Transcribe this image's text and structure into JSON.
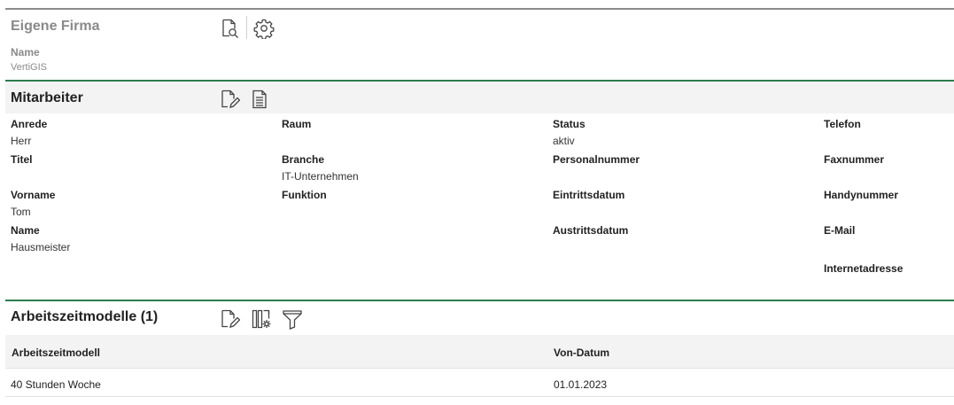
{
  "company": {
    "title": "Eigene Firma",
    "name_label": "Name",
    "name_value": "VertiGIS"
  },
  "employee": {
    "title": "Mitarbeiter",
    "fields": {
      "anrede": {
        "label": "Anrede",
        "value": "Herr"
      },
      "titel": {
        "label": "Titel",
        "value": ""
      },
      "vorname": {
        "label": "Vorname",
        "value": "Tom"
      },
      "name": {
        "label": "Name",
        "value": "Hausmeister"
      },
      "raum": {
        "label": "Raum",
        "value": ""
      },
      "branche": {
        "label": "Branche",
        "value": "IT-Unternehmen"
      },
      "funktion": {
        "label": "Funktion",
        "value": ""
      },
      "status": {
        "label": "Status",
        "value": "aktiv"
      },
      "personalnummer": {
        "label": "Personalnummer",
        "value": ""
      },
      "eintrittsdatum": {
        "label": "Eintrittsdatum",
        "value": ""
      },
      "austrittsdatum": {
        "label": "Austrittsdatum",
        "value": ""
      },
      "telefon": {
        "label": "Telefon",
        "value": ""
      },
      "faxnummer": {
        "label": "Faxnummer",
        "value": ""
      },
      "handynummer": {
        "label": "Handynummer",
        "value": ""
      },
      "email": {
        "label": "E-Mail",
        "value": ""
      },
      "internetadresse": {
        "label": "Internetadresse",
        "value": ""
      }
    }
  },
  "work_models": {
    "title": "Arbeitszeitmodelle (1)",
    "columns": [
      "Arbeitszeitmodell",
      "Von-Datum"
    ],
    "rows": [
      [
        "40 Stunden Woche",
        "01.01.2023"
      ]
    ]
  },
  "icons": {
    "company_search": "document-search-icon",
    "company_settings": "gear-icon",
    "employee_edit": "document-edit-icon",
    "employee_report": "document-lines-icon",
    "models_edit": "document-edit-icon",
    "models_columns": "columns-settings-icon",
    "models_filter": "filter-icon"
  }
}
